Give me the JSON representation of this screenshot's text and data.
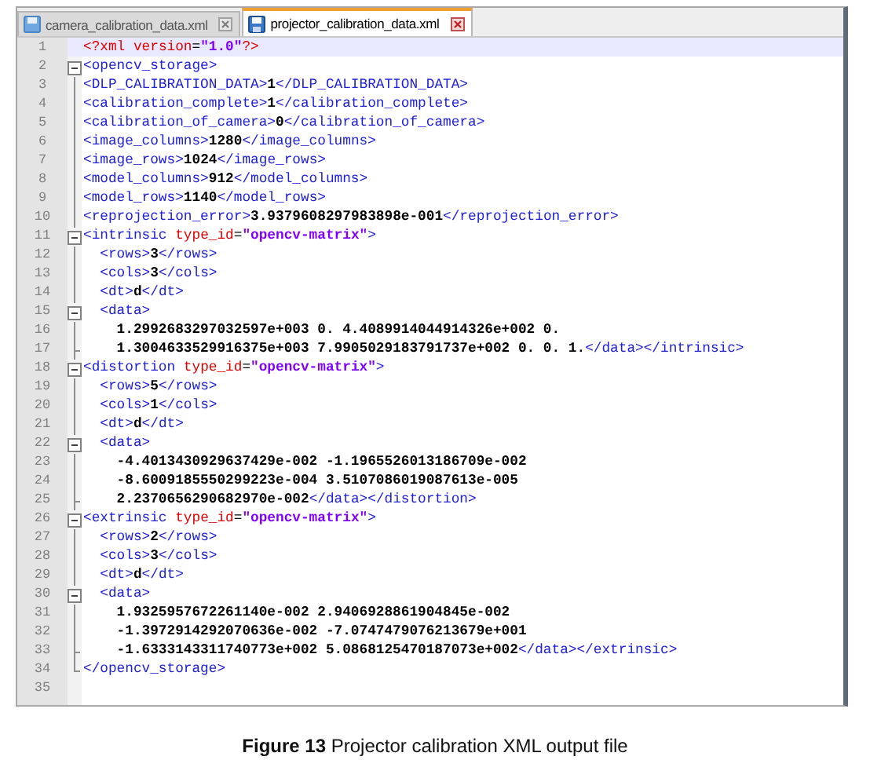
{
  "tabs": [
    {
      "label": "camera_calibration_data.xml",
      "selected": false
    },
    {
      "label": "projector_calibration_data.xml",
      "selected": true
    }
  ],
  "editor": {
    "lines": [
      {
        "number": "1",
        "kind": "plain",
        "current": true,
        "parts": [
          {
            "kind": "pi",
            "text": "<?xml "
          },
          {
            "kind": "attr",
            "text": "version"
          },
          {
            "kind": "sym",
            "text": "="
          },
          {
            "kind": "value",
            "text": "\"1.0\""
          },
          {
            "kind": "pi",
            "text": "?>"
          }
        ]
      },
      {
        "number": "2",
        "kind": "open",
        "current": false,
        "parts": [
          {
            "kind": "tag",
            "text": "<opencv_storage>"
          }
        ]
      },
      {
        "number": "3",
        "kind": "inner",
        "current": false,
        "parts": [
          {
            "kind": "tag",
            "text": "<DLP_CALIBRATION_DATA>"
          },
          {
            "kind": "text",
            "text": "1"
          },
          {
            "kind": "tag",
            "text": "</DLP_CALIBRATION_DATA>"
          }
        ]
      },
      {
        "number": "4",
        "kind": "inner",
        "current": false,
        "parts": [
          {
            "kind": "tag",
            "text": "<calibration_complete>"
          },
          {
            "kind": "text",
            "text": "1"
          },
          {
            "kind": "tag",
            "text": "</calibration_complete>"
          }
        ]
      },
      {
        "number": "5",
        "kind": "inner",
        "current": false,
        "parts": [
          {
            "kind": "tag",
            "text": "<calibration_of_camera>"
          },
          {
            "kind": "text",
            "text": "0"
          },
          {
            "kind": "tag",
            "text": "</calibration_of_camera>"
          }
        ]
      },
      {
        "number": "6",
        "kind": "inner",
        "current": false,
        "parts": [
          {
            "kind": "tag",
            "text": "<image_columns>"
          },
          {
            "kind": "text",
            "text": "1280"
          },
          {
            "kind": "tag",
            "text": "</image_columns>"
          }
        ]
      },
      {
        "number": "7",
        "kind": "inner",
        "current": false,
        "parts": [
          {
            "kind": "tag",
            "text": "<image_rows>"
          },
          {
            "kind": "text",
            "text": "1024"
          },
          {
            "kind": "tag",
            "text": "</image_rows>"
          }
        ]
      },
      {
        "number": "8",
        "kind": "inner",
        "current": false,
        "parts": [
          {
            "kind": "tag",
            "text": "<model_columns>"
          },
          {
            "kind": "text",
            "text": "912"
          },
          {
            "kind": "tag",
            "text": "</model_columns>"
          }
        ]
      },
      {
        "number": "9",
        "kind": "inner",
        "current": false,
        "parts": [
          {
            "kind": "tag",
            "text": "<model_rows>"
          },
          {
            "kind": "text",
            "text": "1140"
          },
          {
            "kind": "tag",
            "text": "</model_rows>"
          }
        ]
      },
      {
        "number": "10",
        "kind": "inner",
        "current": false,
        "parts": [
          {
            "kind": "tag",
            "text": "<reprojection_error>"
          },
          {
            "kind": "text",
            "text": "3.9379608297983898e-001"
          },
          {
            "kind": "tag",
            "text": "</reprojection_error>"
          }
        ]
      },
      {
        "number": "11",
        "kind": "open",
        "current": false,
        "parts": [
          {
            "kind": "tag",
            "text": "<intrinsic"
          },
          {
            "kind": "attr",
            "text": " type_id"
          },
          {
            "kind": "sym",
            "text": "="
          },
          {
            "kind": "value",
            "text": "\"opencv-matrix\""
          },
          {
            "kind": "tag",
            "text": ">"
          }
        ]
      },
      {
        "number": "12",
        "kind": "inner",
        "current": false,
        "parts": [
          {
            "kind": "tag",
            "text": "  <rows>"
          },
          {
            "kind": "text",
            "text": "3"
          },
          {
            "kind": "tag",
            "text": "</rows>"
          }
        ]
      },
      {
        "number": "13",
        "kind": "inner",
        "current": false,
        "parts": [
          {
            "kind": "tag",
            "text": "  <cols>"
          },
          {
            "kind": "text",
            "text": "3"
          },
          {
            "kind": "tag",
            "text": "</cols>"
          }
        ]
      },
      {
        "number": "14",
        "kind": "inner",
        "current": false,
        "parts": [
          {
            "kind": "tag",
            "text": "  <dt>"
          },
          {
            "kind": "text",
            "text": "d"
          },
          {
            "kind": "tag",
            "text": "</dt>"
          }
        ]
      },
      {
        "number": "15",
        "kind": "open",
        "current": false,
        "parts": [
          {
            "kind": "tag",
            "text": "  <data>"
          }
        ]
      },
      {
        "number": "16",
        "kind": "inner",
        "current": false,
        "parts": [
          {
            "kind": "text",
            "text": "    1.2992683297032597e+003 0. 4.4089914044914326e+002 0."
          }
        ]
      },
      {
        "number": "17",
        "kind": "close",
        "current": false,
        "parts": [
          {
            "kind": "text",
            "text": "    1.3004633529916375e+003 7.9905029183791737e+002 0. 0. 1."
          },
          {
            "kind": "tag",
            "text": "</data></intrinsic>"
          }
        ]
      },
      {
        "number": "18",
        "kind": "open",
        "current": false,
        "parts": [
          {
            "kind": "tag",
            "text": "<distortion"
          },
          {
            "kind": "attr",
            "text": " type_id"
          },
          {
            "kind": "sym",
            "text": "="
          },
          {
            "kind": "value",
            "text": "\"opencv-matrix\""
          },
          {
            "kind": "tag",
            "text": ">"
          }
        ]
      },
      {
        "number": "19",
        "kind": "inner",
        "current": false,
        "parts": [
          {
            "kind": "tag",
            "text": "  <rows>"
          },
          {
            "kind": "text",
            "text": "5"
          },
          {
            "kind": "tag",
            "text": "</rows>"
          }
        ]
      },
      {
        "number": "20",
        "kind": "inner",
        "current": false,
        "parts": [
          {
            "kind": "tag",
            "text": "  <cols>"
          },
          {
            "kind": "text",
            "text": "1"
          },
          {
            "kind": "tag",
            "text": "</cols>"
          }
        ]
      },
      {
        "number": "21",
        "kind": "inner",
        "current": false,
        "parts": [
          {
            "kind": "tag",
            "text": "  <dt>"
          },
          {
            "kind": "text",
            "text": "d"
          },
          {
            "kind": "tag",
            "text": "</dt>"
          }
        ]
      },
      {
        "number": "22",
        "kind": "open",
        "current": false,
        "parts": [
          {
            "kind": "tag",
            "text": "  <data>"
          }
        ]
      },
      {
        "number": "23",
        "kind": "inner",
        "current": false,
        "parts": [
          {
            "kind": "text",
            "text": "    -4.4013430929637429e-002 -1.1965526013186709e-002"
          }
        ]
      },
      {
        "number": "24",
        "kind": "inner",
        "current": false,
        "parts": [
          {
            "kind": "text",
            "text": "    -8.6009185550299223e-004 3.5107086019087613e-005"
          }
        ]
      },
      {
        "number": "25",
        "kind": "close",
        "current": false,
        "parts": [
          {
            "kind": "text",
            "text": "    2.2370656290682970e-002"
          },
          {
            "kind": "tag",
            "text": "</data></distortion>"
          }
        ]
      },
      {
        "number": "26",
        "kind": "open",
        "current": false,
        "parts": [
          {
            "kind": "tag",
            "text": "<extrinsic"
          },
          {
            "kind": "attr",
            "text": " type_id"
          },
          {
            "kind": "sym",
            "text": "="
          },
          {
            "kind": "value",
            "text": "\"opencv-matrix\""
          },
          {
            "kind": "tag",
            "text": ">"
          }
        ]
      },
      {
        "number": "27",
        "kind": "inner",
        "current": false,
        "parts": [
          {
            "kind": "tag",
            "text": "  <rows>"
          },
          {
            "kind": "text",
            "text": "2"
          },
          {
            "kind": "tag",
            "text": "</rows>"
          }
        ]
      },
      {
        "number": "28",
        "kind": "inner",
        "current": false,
        "parts": [
          {
            "kind": "tag",
            "text": "  <cols>"
          },
          {
            "kind": "text",
            "text": "3"
          },
          {
            "kind": "tag",
            "text": "</cols>"
          }
        ]
      },
      {
        "number": "29",
        "kind": "inner",
        "current": false,
        "parts": [
          {
            "kind": "tag",
            "text": "  <dt>"
          },
          {
            "kind": "text",
            "text": "d"
          },
          {
            "kind": "tag",
            "text": "</dt>"
          }
        ]
      },
      {
        "number": "30",
        "kind": "open",
        "current": false,
        "parts": [
          {
            "kind": "tag",
            "text": "  <data>"
          }
        ]
      },
      {
        "number": "31",
        "kind": "inner",
        "current": false,
        "parts": [
          {
            "kind": "text",
            "text": "    1.9325957672261140e-002 2.9406928861904845e-002"
          }
        ]
      },
      {
        "number": "32",
        "kind": "inner",
        "current": false,
        "parts": [
          {
            "kind": "text",
            "text": "    -1.3972914292070636e-002 -7.0747479076213679e+001"
          }
        ]
      },
      {
        "number": "33",
        "kind": "close",
        "current": false,
        "parts": [
          {
            "kind": "text",
            "text": "    -1.6333143311740773e+002 5.0868125470187073e+002"
          },
          {
            "kind": "tag",
            "text": "</data></extrinsic>"
          }
        ]
      },
      {
        "number": "34",
        "kind": "end",
        "current": false,
        "parts": [
          {
            "kind": "tag",
            "text": "</opencv_storage>"
          }
        ]
      },
      {
        "number": "35",
        "kind": "plain",
        "current": false
      }
    ]
  },
  "caption": "**Figure 13** Projector calibration XML output file"
}
